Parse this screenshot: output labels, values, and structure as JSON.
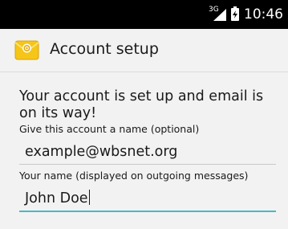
{
  "status_bar": {
    "network_type": "3G",
    "time": "10:46",
    "icons": [
      "signal-icon",
      "battery-charging-icon"
    ]
  },
  "action_bar": {
    "title": "Account setup",
    "icon": "email-app-icon"
  },
  "form": {
    "headline": "Your account is set up and email is on its way!",
    "account_name_label": "Give this account a name (optional)",
    "account_name_value": "example@wbsnet.org",
    "your_name_label": "Your name (displayed on outgoing messages)",
    "your_name_value": "John Doe"
  },
  "colors": {
    "status_bar_bg": "#000000",
    "background": "#f2f2f2",
    "focus_accent": "#4bb8c9",
    "icon_yellow": "#f5c518"
  }
}
